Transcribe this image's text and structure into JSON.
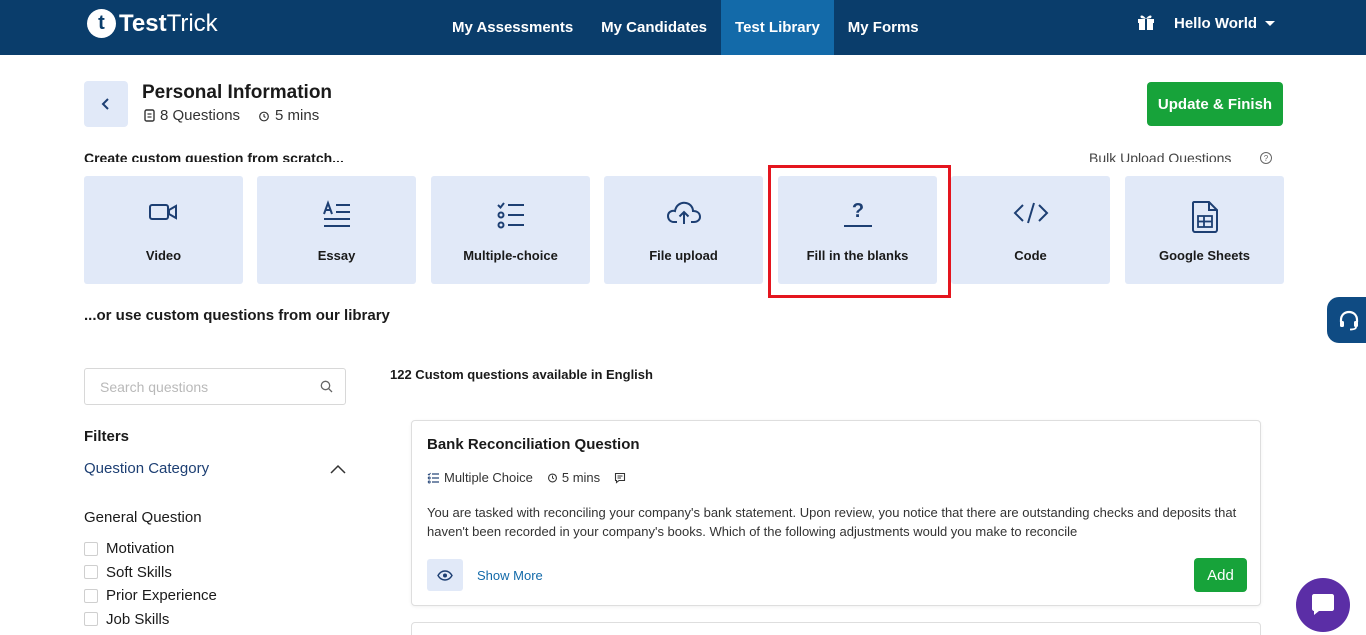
{
  "nav": {
    "logo_letter": "t",
    "logo_bold": "Test",
    "logo_light": "Trick",
    "items": [
      {
        "label": "My Assessments",
        "active": false
      },
      {
        "label": "My Candidates",
        "active": false
      },
      {
        "label": "Test Library",
        "active": true
      },
      {
        "label": "My Forms",
        "active": false
      }
    ],
    "user": "Hello World"
  },
  "header": {
    "title": "Personal Information",
    "questions": "8 Questions",
    "duration": "5 mins",
    "update_label": "Update & Finish"
  },
  "create": {
    "text": "Create custom question from scratch...",
    "bulk_link": "Bulk Upload Questions",
    "help": "?"
  },
  "tiles": [
    {
      "label": "Video",
      "icon": "video-icon"
    },
    {
      "label": "Essay",
      "icon": "essay-icon"
    },
    {
      "label": "Multiple-choice",
      "icon": "list-check-icon"
    },
    {
      "label": "File upload",
      "icon": "cloud-upload-icon"
    },
    {
      "label": "Fill in the blanks",
      "icon": "question-mark-icon"
    },
    {
      "label": "Code",
      "icon": "code-icon"
    },
    {
      "label": "Google Sheets",
      "icon": "spreadsheet-icon"
    }
  ],
  "library_text": "...or use custom questions from our library",
  "sidebar": {
    "search_placeholder": "Search questions",
    "filters_label": "Filters",
    "category_label": "Question Category",
    "group_label": "General Question",
    "options": [
      "Motivation",
      "Soft Skills",
      "Prior Experience",
      "Job Skills"
    ]
  },
  "main": {
    "available_text": "122 Custom questions available in English",
    "card": {
      "title": "Bank Reconciliation Question",
      "type": "Multiple Choice",
      "duration": "5 mins",
      "description": "You are tasked with reconciling your company's bank statement. Upon review, you notice that there are outstanding checks and deposits that haven't been recorded in your company's books. Which of the following adjustments would you make to reconcile",
      "show_more": "Show More",
      "add_label": "Add"
    }
  },
  "colors": {
    "nav_bg": "#0a3d6b",
    "nav_active": "#136aa9",
    "accent_green": "#17a33a",
    "tile_bg": "#e1e9f8",
    "highlight_red": "#e4151e",
    "chat_purple": "#5b2ea6"
  }
}
